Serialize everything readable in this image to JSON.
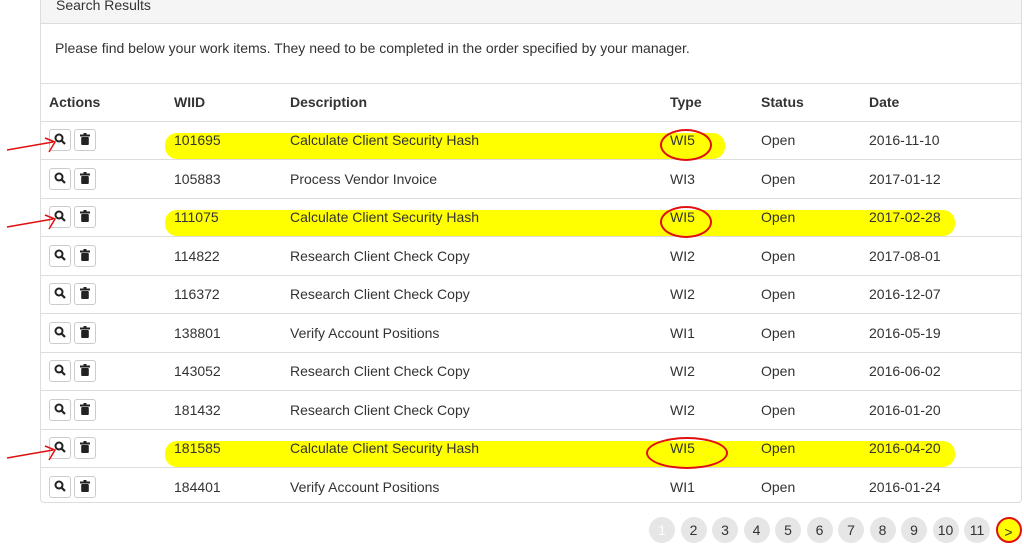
{
  "panel": {
    "title": "Search Results",
    "intro": "Please find below your work items. They need to be completed in the order specified by your manager."
  },
  "columns": [
    "Actions",
    "WIID",
    "Description",
    "Type",
    "Status",
    "Date"
  ],
  "rows": [
    {
      "wiid": "101695",
      "description": "Calculate Client Security Hash",
      "type": "WI5",
      "status": "Open",
      "date": "2016-11-10",
      "highlighted": true
    },
    {
      "wiid": "105883",
      "description": "Process Vendor Invoice",
      "type": "WI3",
      "status": "Open",
      "date": "2017-01-12",
      "highlighted": false
    },
    {
      "wiid": "111075",
      "description": "Calculate Client Security Hash",
      "type": "WI5",
      "status": "Open",
      "date": "2017-02-28",
      "highlighted": true
    },
    {
      "wiid": "114822",
      "description": "Research Client Check Copy",
      "type": "WI2",
      "status": "Open",
      "date": "2017-08-01",
      "highlighted": false
    },
    {
      "wiid": "116372",
      "description": "Research Client Check Copy",
      "type": "WI2",
      "status": "Open",
      "date": "2016-12-07",
      "highlighted": false
    },
    {
      "wiid": "138801",
      "description": "Verify Account Positions",
      "type": "WI1",
      "status": "Open",
      "date": "2016-05-19",
      "highlighted": false
    },
    {
      "wiid": "143052",
      "description": "Research Client Check Copy",
      "type": "WI2",
      "status": "Open",
      "date": "2016-06-02",
      "highlighted": false
    },
    {
      "wiid": "181432",
      "description": "Research Client Check Copy",
      "type": "WI2",
      "status": "Open",
      "date": "2016-01-20",
      "highlighted": false
    },
    {
      "wiid": "181585",
      "description": "Calculate Client Security Hash",
      "type": "WI5",
      "status": "Open",
      "date": "2016-04-20",
      "highlighted": true
    },
    {
      "wiid": "184401",
      "description": "Verify Account Positions",
      "type": "WI1",
      "status": "Open",
      "date": "2016-01-24",
      "highlighted": false
    }
  ],
  "pagination": {
    "pages": [
      "1",
      "2",
      "3",
      "4",
      "5",
      "6",
      "7",
      "8",
      "9",
      "10",
      "11"
    ],
    "current": "1",
    "next": ">"
  },
  "colors": {
    "highlight": "#ffff00",
    "annotation": "#e01010"
  }
}
